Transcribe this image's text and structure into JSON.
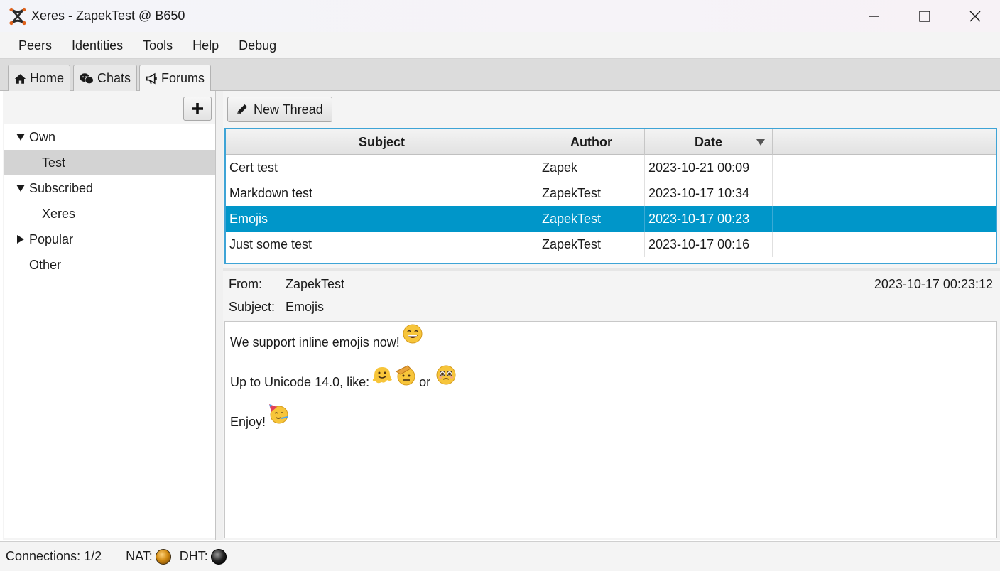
{
  "window": {
    "title": "Xeres - ZapekTest @ B650",
    "controls": [
      "minimize-icon",
      "maximize-icon",
      "close-icon"
    ]
  },
  "menu": [
    "Peers",
    "Identities",
    "Tools",
    "Help",
    "Debug"
  ],
  "tabs": [
    {
      "label": "Home",
      "icon": "home-icon"
    },
    {
      "label": "Chats",
      "icon": "chat-icon"
    },
    {
      "label": "Forums",
      "icon": "megaphone-icon",
      "active": true
    }
  ],
  "sidebar": {
    "add_icon": "plus-icon",
    "tree": [
      {
        "label": "Own",
        "expanded": true
      },
      {
        "label": "Test",
        "selected": true
      },
      {
        "label": "Subscribed",
        "expanded": true
      },
      {
        "label": "Xeres"
      },
      {
        "label": "Popular",
        "expanded": false
      },
      {
        "label": "Other"
      }
    ]
  },
  "toolbar": {
    "new_thread_label": "New Thread",
    "new_thread_icon": "pencil-icon"
  },
  "table": {
    "columns": [
      "Subject",
      "Author",
      "Date"
    ],
    "sort_column": "Date",
    "rows": [
      {
        "subject": "Cert test",
        "author": "Zapek",
        "date": "2023-10-21 00:09"
      },
      {
        "subject": "Markdown test",
        "author": "ZapekTest",
        "date": "2023-10-17 10:34"
      },
      {
        "subject": "Emojis",
        "author": "ZapekTest",
        "date": "2023-10-17 00:23",
        "selected": true
      },
      {
        "subject": "Just some test",
        "author": "ZapekTest",
        "date": "2023-10-17 00:16"
      }
    ]
  },
  "message": {
    "from_label": "From:",
    "from_value": "ZapekTest",
    "subject_label": "Subject:",
    "subject_value": "Emojis",
    "timestamp": "2023-10-17 00:23:12",
    "line1": "We support inline emojis now!",
    "line2": "Up to Unicode 14.0, like:",
    "line2_or": "or",
    "line3": "Enjoy!"
  },
  "status": {
    "connections": "Connections: 1/2",
    "nat_label": "NAT:",
    "dht_label": "DHT:",
    "nat_color": "#d18a12",
    "dht_color": "#111111"
  }
}
